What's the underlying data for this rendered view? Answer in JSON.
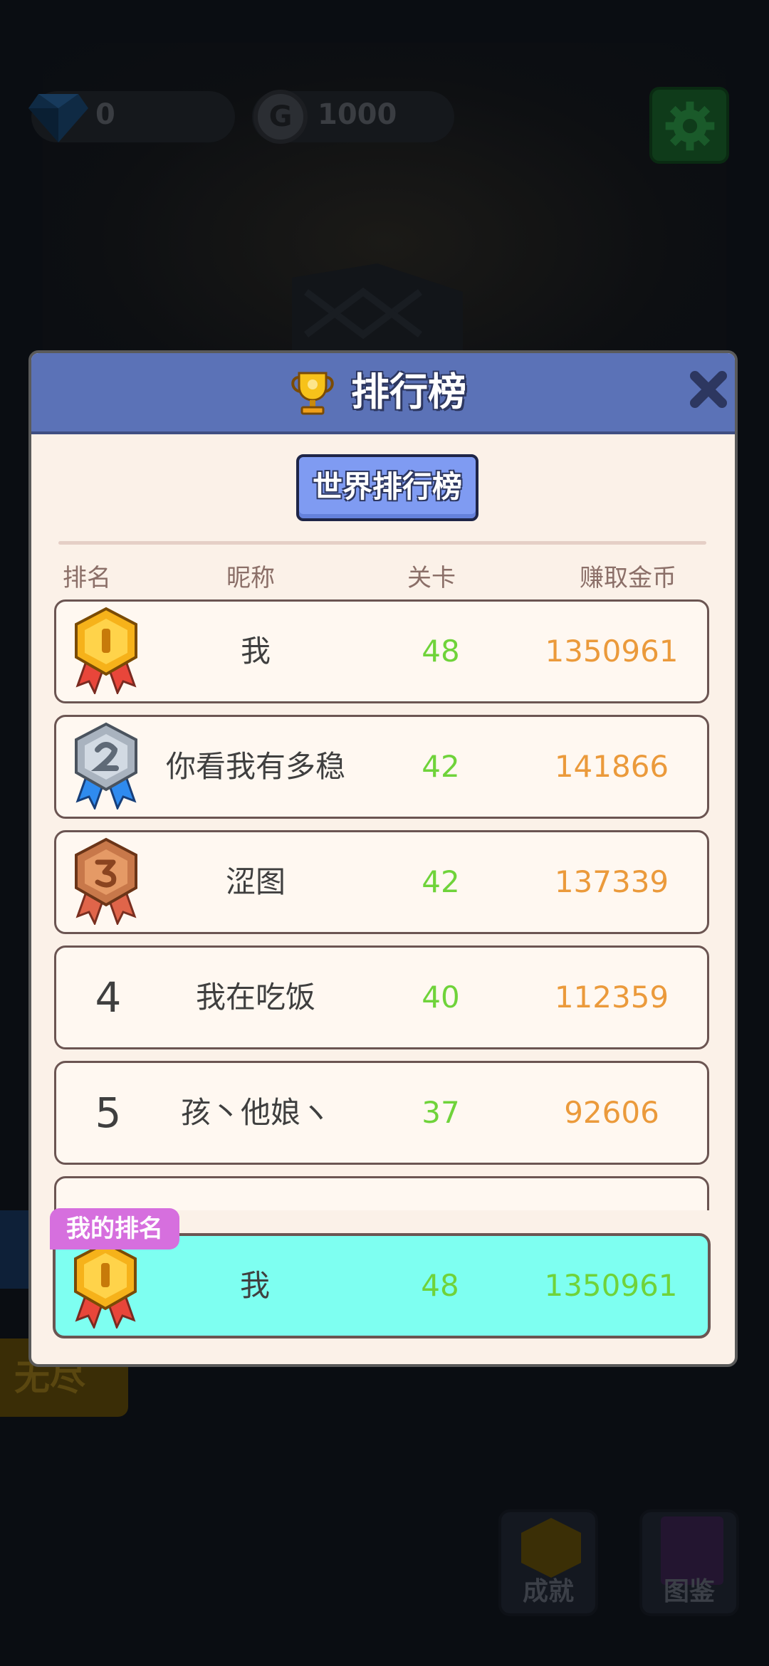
{
  "background": {
    "gems": "0",
    "coins": "1000",
    "coin_icon_letter": "G",
    "mode_button": "无尽",
    "achievements_label": "成就",
    "collection_label": "图鉴"
  },
  "modal": {
    "title": "排行榜",
    "tab_label": "世界排行榜",
    "columns": {
      "rank": "排名",
      "nickname": "昵称",
      "level": "关卡",
      "coins": "赚取金币"
    },
    "rows": [
      {
        "rank": "1",
        "medal": "gold-medal-icon",
        "name": "我",
        "level": "48",
        "coins": "1350961"
      },
      {
        "rank": "2",
        "medal": "silver-medal-icon",
        "name": "你看我有多稳",
        "level": "42",
        "coins": "141866"
      },
      {
        "rank": "3",
        "medal": "bronze-medal-icon",
        "name": "涩图",
        "level": "42",
        "coins": "137339"
      },
      {
        "rank": "4",
        "medal": "",
        "name": "我在吃饭",
        "level": "40",
        "coins": "112359"
      },
      {
        "rank": "5",
        "medal": "",
        "name": "孩丶他娘ヽ",
        "level": "37",
        "coins": "92606"
      }
    ],
    "my_rank": {
      "tag": "我的排名",
      "rank": "1",
      "medal": "gold-medal-icon",
      "name": "我",
      "level": "48",
      "coins": "1350961"
    }
  },
  "colors": {
    "header": "#5b72b7",
    "panel": "#fbf1e8",
    "level_green": "#6fd33a",
    "coins_orange": "#eb9a3b",
    "my_row_bg": "#7efff1",
    "my_tag_bg": "#d66fde"
  }
}
